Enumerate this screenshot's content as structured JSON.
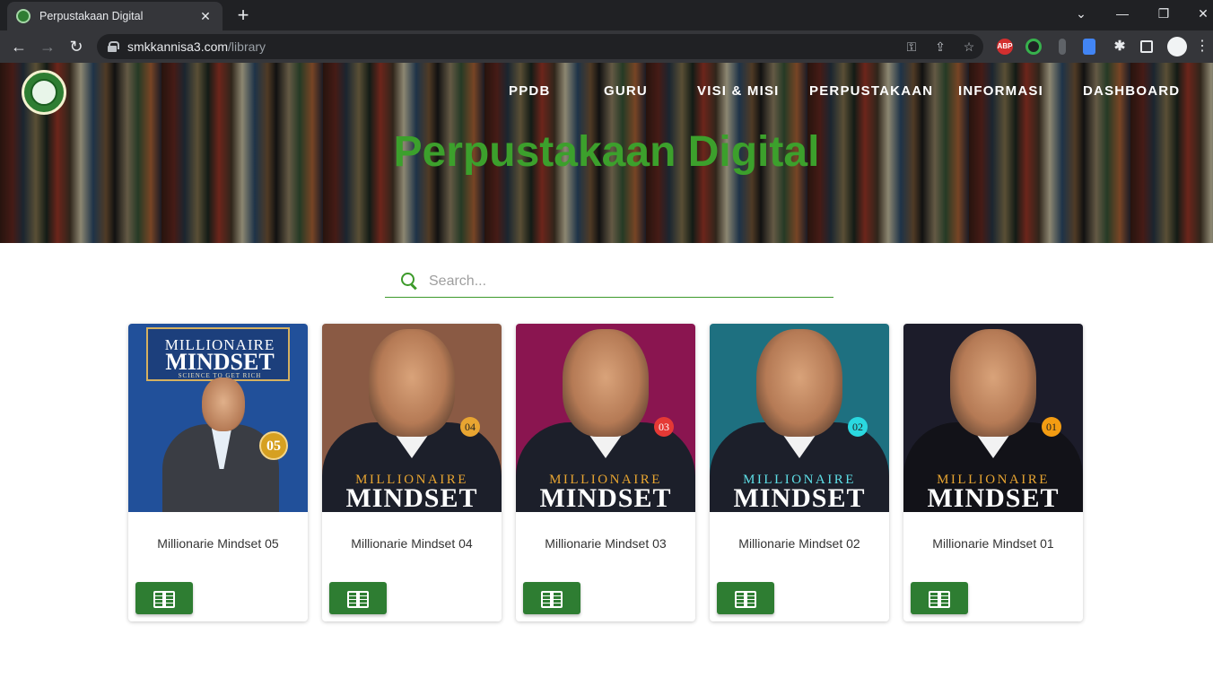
{
  "browser": {
    "tab_title": "Perpustakaan Digital",
    "tab_close": "✕",
    "new_tab": "+",
    "url_host": "smkkannisa3.com",
    "url_path": "/library",
    "window_controls": [
      "⌄",
      "—",
      "❐",
      "✕"
    ],
    "ext_abp": "ABP"
  },
  "nav": {
    "items": [
      "PPDB",
      "GURU",
      "VISI & MISI",
      "PERPUSTAKAAN",
      "INFORMASI",
      "DASHBOARD"
    ]
  },
  "hero": {
    "title": "Perpustakaan Digital"
  },
  "search": {
    "placeholder": "Search..."
  },
  "books": [
    {
      "title": "Millionarie Mindset 05",
      "cover_top": "MILLIONAIRE",
      "cover_main": "MINDSET",
      "cover_sub": "SCIENCE TO GET RICH",
      "issue": "05",
      "cover_color": "#21509a"
    },
    {
      "title": "Millionarie Mindset 04",
      "cover_top": "MILLIONAIRE",
      "cover_main": "MINDSET",
      "issue": "04",
      "cover_color": "#8a5a44",
      "badge_color": "#e8a531"
    },
    {
      "title": "Millionarie Mindset 03",
      "cover_top": "MILLIONAIRE",
      "cover_main": "MINDSET",
      "issue": "03",
      "cover_color": "#8a1550",
      "badge_color": "#e53935"
    },
    {
      "title": "Millionarie Mindset 02",
      "cover_top": "MILLIONAIRE",
      "cover_main": "MINDSET",
      "issue": "02",
      "cover_color": "#1e7080",
      "badge_color": "#2ad8e0"
    },
    {
      "title": "Millionarie Mindset 01",
      "cover_top": "MILLIONAIRE",
      "cover_main": "MINDSET",
      "issue": "01",
      "cover_color": "#1c1c2a",
      "badge_color": "#f39c12"
    }
  ],
  "colors": {
    "accent_green": "#3ca02c",
    "button_green": "#2e7d32"
  }
}
